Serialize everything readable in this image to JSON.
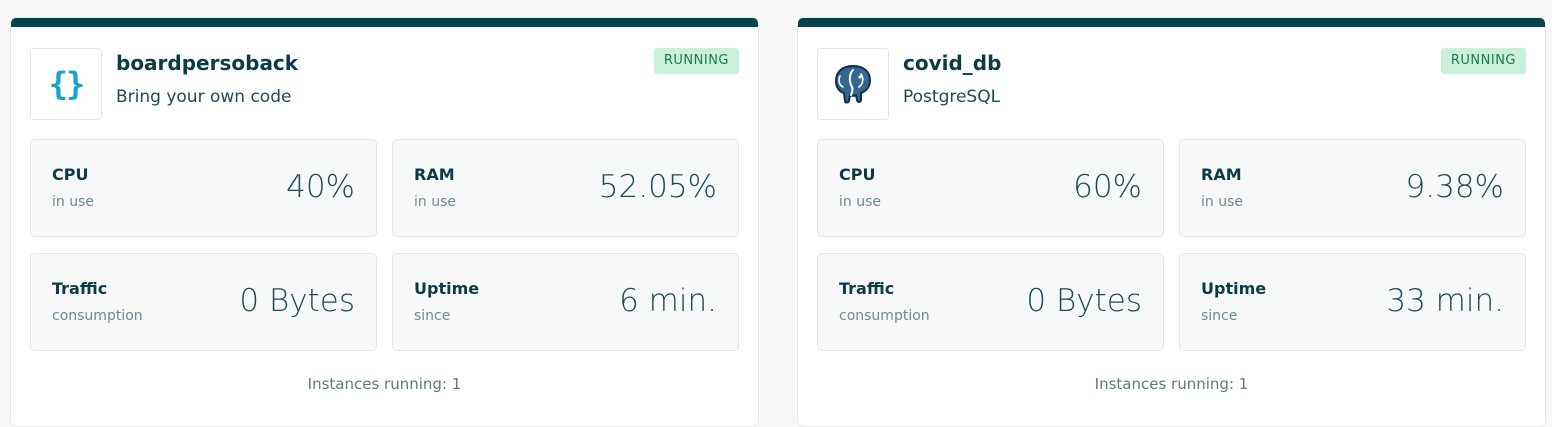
{
  "cards": [
    {
      "name": "boardpersoback",
      "subtitle": "Bring your own code",
      "icon": "code-braces-icon",
      "logo_text": "{}",
      "status": "RUNNING",
      "cpu": {
        "label": "CPU",
        "sub": "in use",
        "value": "40%"
      },
      "ram": {
        "label": "RAM",
        "sub": "in use",
        "value": "52.05%"
      },
      "traffic": {
        "label": "Traffic",
        "sub": "consumption",
        "value": "0 Bytes"
      },
      "uptime": {
        "label": "Uptime",
        "sub": "since",
        "value": "6 min."
      },
      "instances": "Instances running: 1"
    },
    {
      "name": "covid_db",
      "subtitle": "PostgreSQL",
      "icon": "postgresql-elephant-icon",
      "status": "RUNNING",
      "cpu": {
        "label": "CPU",
        "sub": "in use",
        "value": "60%"
      },
      "ram": {
        "label": "RAM",
        "sub": "in use",
        "value": "9.38%"
      },
      "traffic": {
        "label": "Traffic",
        "sub": "consumption",
        "value": "0 Bytes"
      },
      "uptime": {
        "label": "Uptime",
        "sub": "since",
        "value": "33 min."
      },
      "instances": "Instances running: 1"
    }
  ],
  "colors": {
    "header_bar": "#05434f",
    "badge_bg": "#c8f0da",
    "badge_text": "#1f7a4c",
    "brace_icon": "#1aa3c8"
  }
}
